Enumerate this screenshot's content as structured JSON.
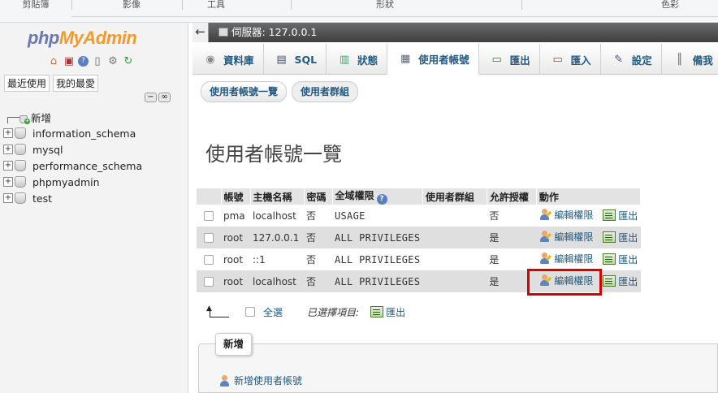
{
  "ribbon": {
    "groups": [
      "剪貼簿",
      "影像",
      "工具",
      "形狀",
      "色彩"
    ]
  },
  "nav": {
    "logo_php": "php",
    "logo_myadmin": "MyAdmin",
    "quick_icons": [
      "home-icon",
      "logout-icon",
      "help-icon",
      "docs-icon",
      "settings-icon",
      "reload-icon"
    ],
    "tabs": [
      "最近使用",
      "我的最愛"
    ],
    "new_label": "新增",
    "databases": [
      "information_schema",
      "mysql",
      "performance_schema",
      "phpmyadmin",
      "test"
    ]
  },
  "server": {
    "label": "伺服器: 127.0.0.1"
  },
  "top_menu": [
    {
      "label": "資料庫",
      "icon": "database-icon"
    },
    {
      "label": "SQL",
      "icon": "sql-icon"
    },
    {
      "label": "狀態",
      "icon": "status-icon"
    },
    {
      "label": "使用者帳號",
      "icon": "users-icon",
      "active": true
    },
    {
      "label": "匯出",
      "icon": "export-icon"
    },
    {
      "label": "匯入",
      "icon": "import-icon"
    },
    {
      "label": "設定",
      "icon": "settings-icon"
    },
    {
      "label": "備我",
      "icon": "binlog-icon"
    }
  ],
  "sub_tabs": [
    "使用者帳號一覽",
    "使用者群組"
  ],
  "page_title": "使用者帳號一覽",
  "table": {
    "headers": [
      "帳號",
      "主機名稱",
      "密碼",
      "全域權限",
      "使用者群組",
      "允許授權",
      "動作"
    ],
    "rows": [
      {
        "user": "pma",
        "host": "localhost",
        "password": "否",
        "privileges": "USAGE",
        "group": "",
        "grant": "否",
        "edit": "編輯權限",
        "export": "匯出"
      },
      {
        "user": "root",
        "host": "127.0.0.1",
        "password": "否",
        "privileges": "ALL PRIVILEGES",
        "group": "",
        "grant": "是",
        "edit": "編輯權限",
        "export": "匯出"
      },
      {
        "user": "root",
        "host": "::1",
        "password": "否",
        "privileges": "ALL PRIVILEGES",
        "group": "",
        "grant": "是",
        "edit": "編輯權限",
        "export": "匯出"
      },
      {
        "user": "root",
        "host": "localhost",
        "password": "否",
        "privileges": "ALL PRIVILEGES",
        "group": "",
        "grant": "是",
        "edit": "編輯權限",
        "export": "匯出"
      }
    ]
  },
  "bulk": {
    "select_all": "全選",
    "with_selected": "已選擇項目:",
    "export": "匯出"
  },
  "new_section": {
    "legend": "新增",
    "add_user": "新增使用者帳號"
  },
  "colors": {
    "link": "#235a81",
    "negative": "#cc0000",
    "highlight": "#d40000",
    "logo_php": "#6c78af",
    "logo_myadmin": "#f29a2e"
  }
}
